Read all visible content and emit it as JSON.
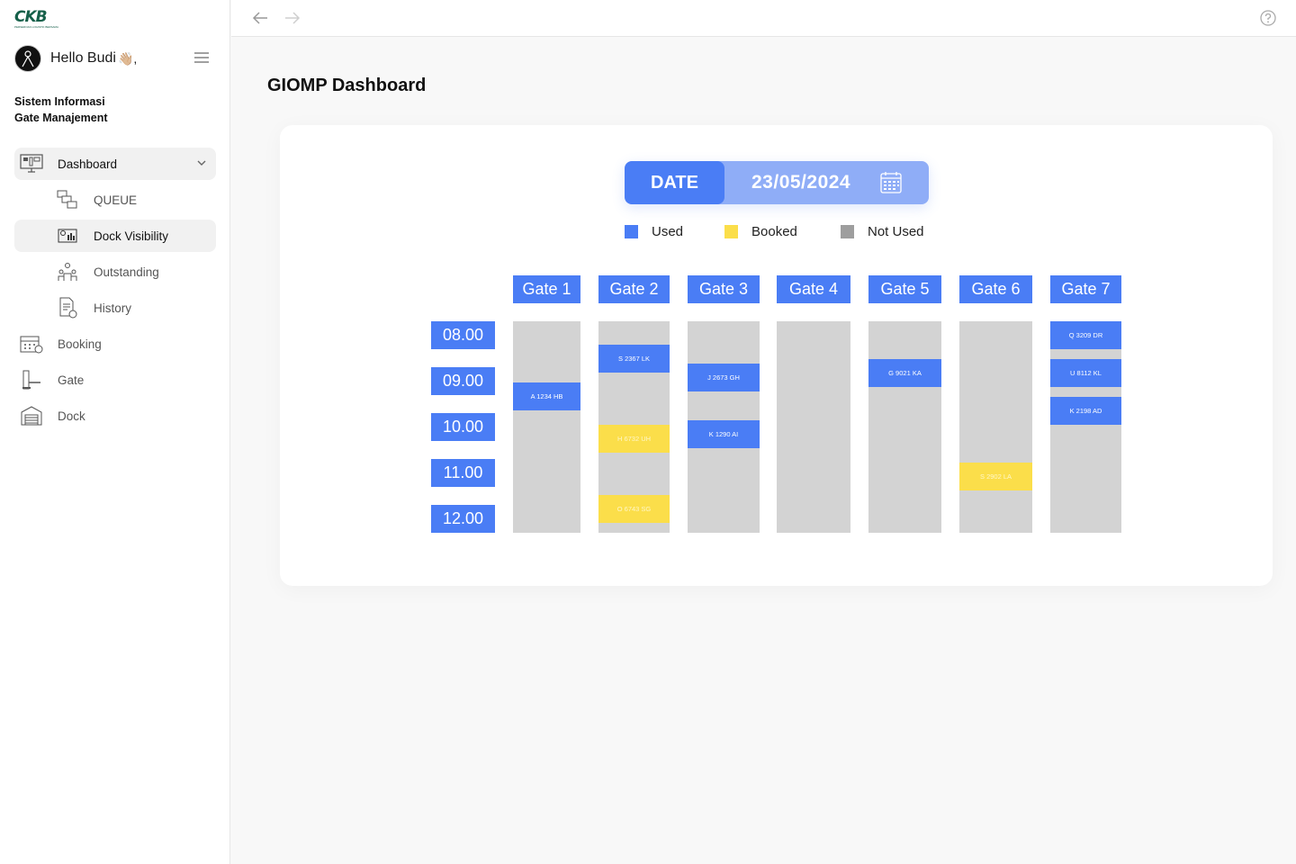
{
  "app": {
    "logo_text": "CKB",
    "logo_sub": "PERSEROAN LOGISTIK BERSAMA",
    "greeting": "Hello Budi",
    "greeting_suffix": "👋🏼,",
    "title_line1": "Sistem Informasi",
    "title_line2": "Gate Manajement"
  },
  "sidebar": {
    "items": [
      {
        "label": "Dashboard",
        "icon": "dashboard-monitor-icon"
      },
      {
        "label": "QUEUE",
        "icon": "queue-icon"
      },
      {
        "label": "Dock Visibility",
        "icon": "dock-visibility-icon"
      },
      {
        "label": "Outstanding",
        "icon": "outstanding-icon"
      },
      {
        "label": "History",
        "icon": "history-document-icon"
      },
      {
        "label": "Booking",
        "icon": "booking-calendar-icon"
      },
      {
        "label": "Gate",
        "icon": "gate-icon"
      },
      {
        "label": "Dock",
        "icon": "dock-warehouse-icon"
      }
    ],
    "active": "Dock Visibility"
  },
  "page": {
    "title": "GIOMP Dashboard"
  },
  "date_picker": {
    "label": "DATE",
    "value": "23/05/2024"
  },
  "legend": [
    {
      "label": "Used",
      "color": "#4a7df5"
    },
    {
      "label": "Booked",
      "color": "#fbde4a"
    },
    {
      "label": "Not Used",
      "color": "#9e9e9e"
    }
  ],
  "colors": {
    "accent": "#4a7df5",
    "booked": "#fbde4a",
    "not_used": "#d3d3d3"
  },
  "schedule": {
    "times": [
      "08.00",
      "09.00",
      "10.00",
      "11.00",
      "12.00"
    ],
    "gates": [
      {
        "name": "Gate 1",
        "slots": [
          {
            "plate": "A 1234 HB",
            "status": "used",
            "start": 9.3
          }
        ]
      },
      {
        "name": "Gate 2",
        "slots": [
          {
            "plate": "S 2367 LK",
            "status": "used",
            "start": 8.5
          },
          {
            "plate": "H 6732 UH",
            "status": "booked",
            "start": 10.2
          },
          {
            "plate": "O 6743 SG",
            "status": "booked",
            "start": 11.7
          }
        ]
      },
      {
        "name": "Gate 3",
        "slots": [
          {
            "plate": "J 2673 GH",
            "status": "used",
            "start": 8.9
          },
          {
            "plate": "K 1290 AI",
            "status": "used",
            "start": 10.1
          }
        ]
      },
      {
        "name": "Gate 4",
        "slots": []
      },
      {
        "name": "Gate 5",
        "slots": [
          {
            "plate": "G 9021 KA",
            "status": "used",
            "start": 8.8
          }
        ]
      },
      {
        "name": "Gate 6",
        "slots": [
          {
            "plate": "S 2902 LA",
            "status": "booked",
            "start": 11.0
          }
        ]
      },
      {
        "name": "Gate 7",
        "slots": [
          {
            "plate": "Q 3209 DR",
            "status": "used",
            "start": 8.0
          },
          {
            "plate": "U 8112 KL",
            "status": "used",
            "start": 8.8
          },
          {
            "plate": "K 2198 AD",
            "status": "used",
            "start": 9.6
          }
        ]
      }
    ]
  }
}
